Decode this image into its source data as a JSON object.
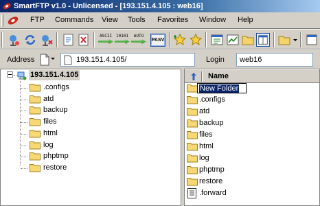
{
  "window": {
    "title": "SmartFTP v1.0 - Unlicensed - [193.151.4.105 : web16]"
  },
  "menu": [
    "FTP",
    "Commands",
    "View",
    "Tools",
    "Favorites",
    "Window",
    "Help"
  ],
  "toolbar": {
    "ascii": "ASCII",
    "binary": "10101",
    "auto": "AUTO",
    "pasv": "PASV"
  },
  "address": {
    "label": "Address",
    "value": "193.151.4.105/"
  },
  "login": {
    "label": "Login",
    "value": "web16"
  },
  "tree": {
    "server": "193.151.4.105",
    "folders": [
      ".configs",
      "atd",
      "backup",
      "files",
      "html",
      "log",
      "phptmp",
      "restore"
    ]
  },
  "filelist": {
    "column_name": "Name",
    "editing": "New Folder",
    "folders": [
      ".configs",
      "atd",
      "backup",
      "files",
      "html",
      "log",
      "phptmp",
      "restore"
    ],
    "files": [
      ".forward"
    ]
  },
  "colors": {
    "folder": "#f8d775",
    "selection": "#0a246a",
    "title_start": "#0a246a",
    "title_end": "#a6caf0"
  }
}
